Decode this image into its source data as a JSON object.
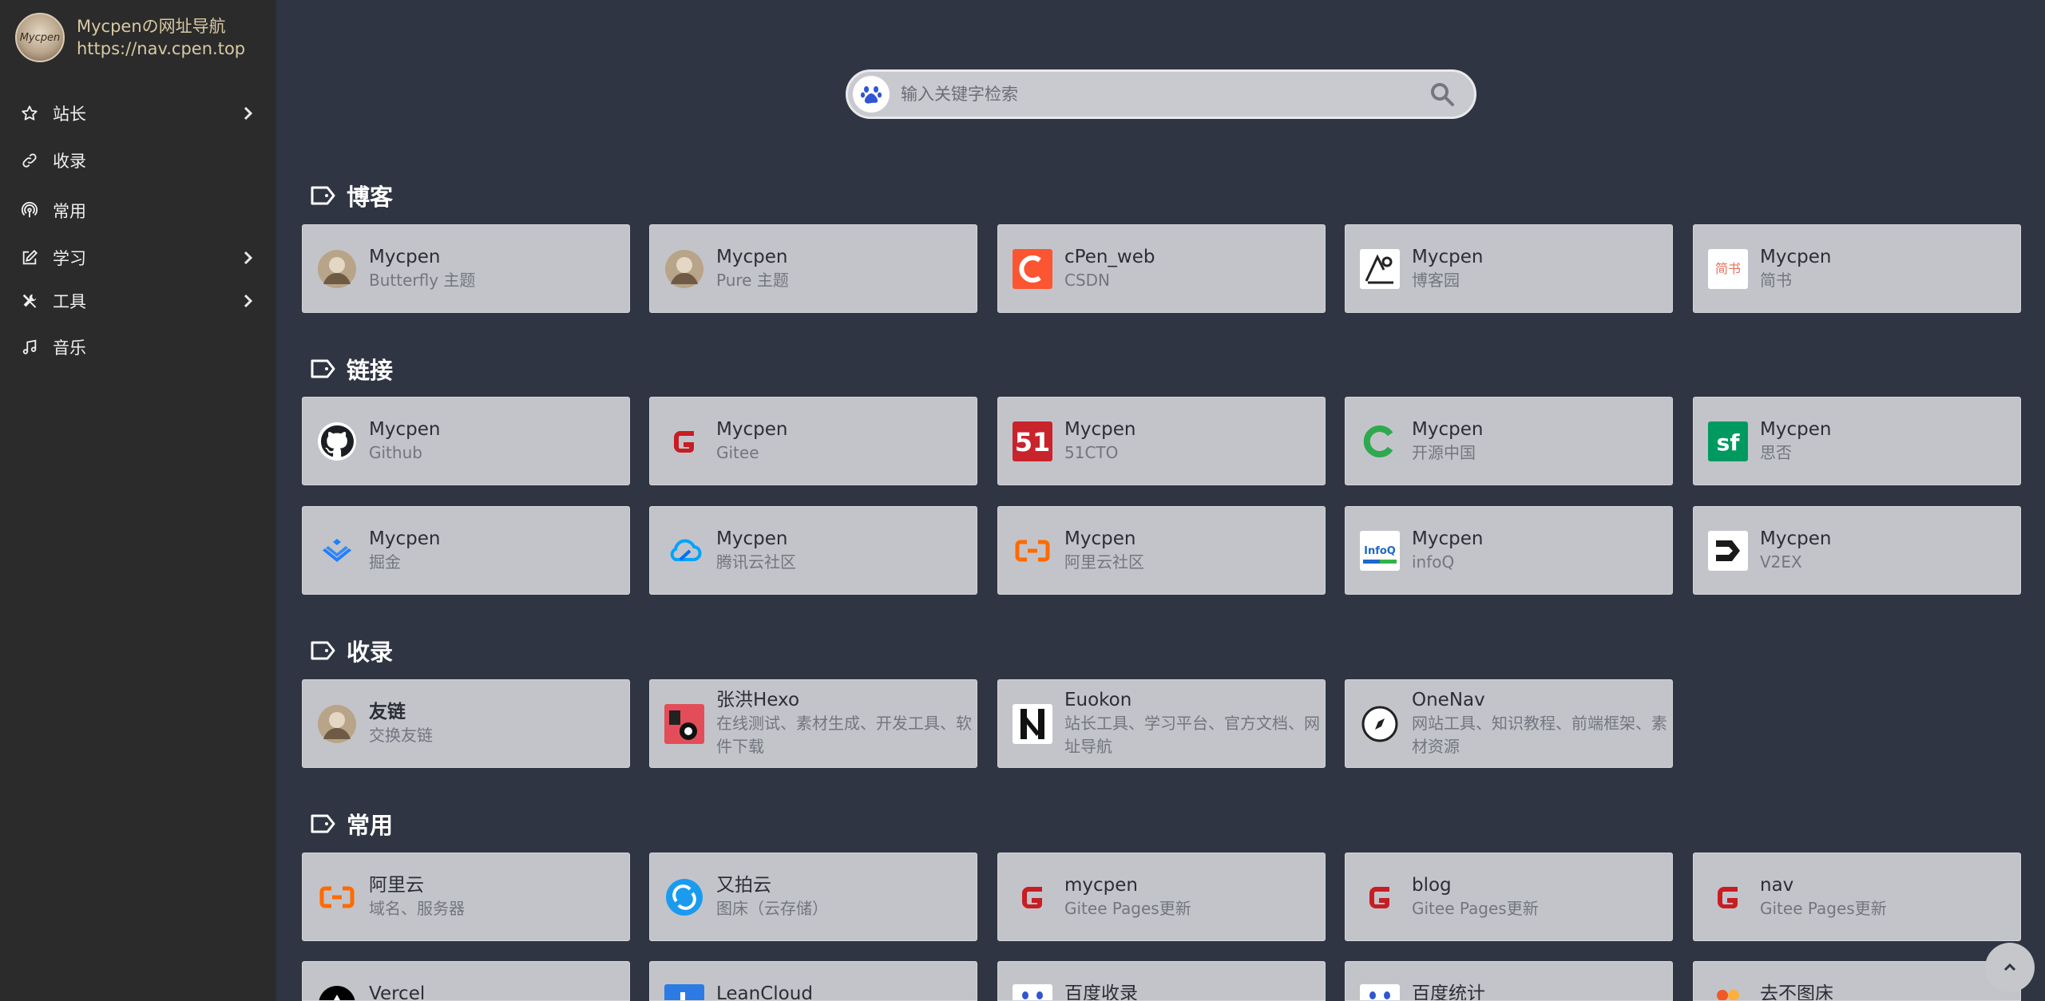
{
  "brand": {
    "avatar_text": "Mycpen",
    "name": "Mycpenの网址导航",
    "url": "https://nav.cpen.top"
  },
  "sidebar": {
    "items": [
      {
        "label": "站长",
        "icon": "star-icon",
        "has_submenu": true
      },
      {
        "label": "收录",
        "icon": "link-icon",
        "has_submenu": false
      },
      {
        "label": "常用",
        "icon": "broadcast-icon",
        "has_submenu": false
      },
      {
        "label": "学习",
        "icon": "edit-icon",
        "has_submenu": true
      },
      {
        "label": "工具",
        "icon": "tools-icon",
        "has_submenu": true
      },
      {
        "label": "音乐",
        "icon": "music-icon",
        "has_submenu": false
      }
    ]
  },
  "search": {
    "placeholder": "输入关键字检索",
    "engine_icon": "baidu-paw-icon"
  },
  "sections": [
    {
      "title": "博客",
      "cards": [
        {
          "title": "Mycpen",
          "desc": "Butterfly 主题",
          "icon": "avatar-icon"
        },
        {
          "title": "Mycpen",
          "desc": "Pure 主题",
          "icon": "avatar-icon"
        },
        {
          "title": "cPen_web",
          "desc": "CSDN",
          "icon": "csdn-icon"
        },
        {
          "title": "Mycpen",
          "desc": "博客园",
          "icon": "cnblogs-icon"
        },
        {
          "title": "Mycpen",
          "desc": "简书",
          "icon": "jianshu-icon",
          "logo_text": "简书"
        }
      ]
    },
    {
      "title": "链接",
      "cards": [
        {
          "title": "Mycpen",
          "desc": "Github",
          "icon": "github-icon"
        },
        {
          "title": "Mycpen",
          "desc": "Gitee",
          "icon": "gitee-icon"
        },
        {
          "title": "Mycpen",
          "desc": "51CTO",
          "icon": "51cto-icon",
          "logo_text": "51"
        },
        {
          "title": "Mycpen",
          "desc": "开源中国",
          "icon": "oschina-icon"
        },
        {
          "title": "Mycpen",
          "desc": "思否",
          "icon": "segmentfault-icon",
          "logo_text": "sf"
        },
        {
          "title": "Mycpen",
          "desc": "掘金",
          "icon": "juejin-icon"
        },
        {
          "title": "Mycpen",
          "desc": "腾讯云社区",
          "icon": "tencent-cloud-icon"
        },
        {
          "title": "Mycpen",
          "desc": "阿里云社区",
          "icon": "aliyun-icon"
        },
        {
          "title": "Mycpen",
          "desc": "infoQ",
          "icon": "infoq-icon",
          "logo_text": "InfoQ"
        },
        {
          "title": "Mycpen",
          "desc": "V2EX",
          "icon": "v2ex-icon"
        }
      ]
    },
    {
      "title": "收录",
      "cards": [
        {
          "title": "友链",
          "desc": "交换友链",
          "icon": "avatar-icon"
        },
        {
          "title": "张洪Hexo",
          "desc": "在线测试、素材生成、开发工具、软件下载",
          "icon": "zhanghong-hexo-icon"
        },
        {
          "title": "Euokon",
          "desc": "站长工具、学习平台、官方文档、网址导航",
          "icon": "euokon-icon"
        },
        {
          "title": "OneNav",
          "desc": "网站工具、知识教程、前端框架、素材资源",
          "icon": "onenav-compass-icon"
        }
      ]
    },
    {
      "title": "常用",
      "cards": [
        {
          "title": "阿里云",
          "desc": "域名、服务器",
          "icon": "aliyun-icon"
        },
        {
          "title": "又拍云",
          "desc": "图床（云存储）",
          "icon": "upyun-icon"
        },
        {
          "title": "mycpen",
          "desc": "Gitee Pages更新",
          "icon": "gitee-icon"
        },
        {
          "title": "blog",
          "desc": "Gitee Pages更新",
          "icon": "gitee-icon"
        },
        {
          "title": "nav",
          "desc": "Gitee Pages更新",
          "icon": "gitee-icon"
        },
        {
          "title": "Vercel",
          "desc": "",
          "icon": "vercel-icon"
        },
        {
          "title": "LeanCloud",
          "desc": "",
          "icon": "leancloud-icon"
        },
        {
          "title": "百度收录",
          "desc": "",
          "icon": "baidu-paw-icon"
        },
        {
          "title": "百度统计",
          "desc": "",
          "icon": "baidu-paw-icon"
        },
        {
          "title": "去不图床",
          "desc": "",
          "icon": "qubu-icon"
        }
      ]
    }
  ],
  "colors": {
    "page_bg": "#2f3542",
    "sidebar_bg": "#2b2b2b",
    "card_bg": "#c3c4c9",
    "brand_text": "#d8c9a3"
  },
  "back_to_top_icon": "chevron-up-icon"
}
